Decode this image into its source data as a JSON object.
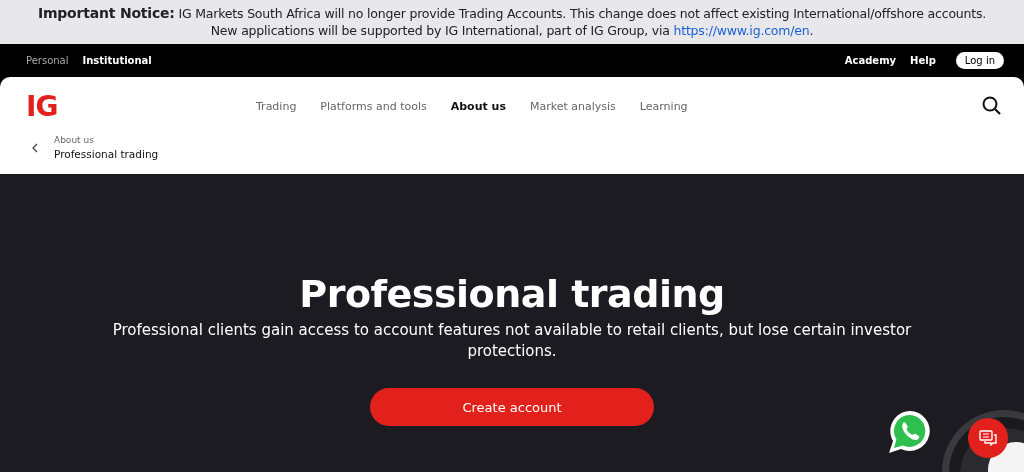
{
  "notice": {
    "label": "Important Notice:",
    "text": "IG Markets South Africa will no longer provide Trading Accounts. This change does not affect existing International/offshore accounts. New applications will be supported by IG International, part of IG Group, via ",
    "link": "https://www.ig.com/en",
    "end": "."
  },
  "top_bar": {
    "segments": [
      {
        "label": "Personal",
        "selected": false
      },
      {
        "label": "Institutional",
        "selected": true
      }
    ],
    "links": [
      "Academy",
      "Help"
    ],
    "login": "Log in"
  },
  "nav": {
    "logo": "IG",
    "items": [
      {
        "label": "Trading",
        "selected": false
      },
      {
        "label": "Platforms and tools",
        "selected": false
      },
      {
        "label": "About us",
        "selected": true
      },
      {
        "label": "Market analysis",
        "selected": false
      },
      {
        "label": "Learning",
        "selected": false
      }
    ]
  },
  "breadcrumb": {
    "parent": "About us",
    "current": "Professional trading"
  },
  "hero": {
    "title": "Professional trading",
    "subtitle": "Professional clients gain access to account features not available to retail clients, but lose certain investor protections.",
    "cta": "Create account"
  }
}
